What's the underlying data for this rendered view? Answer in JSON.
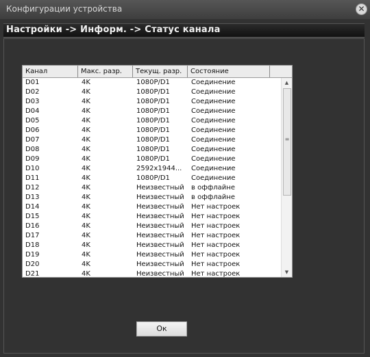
{
  "window": {
    "title": "Конфигурации устройства"
  },
  "breadcrumb": "Настройки -> Информ. -> Статус канала",
  "table": {
    "columns": [
      "Канал",
      "Макс. разр.",
      "Текущ. разр.",
      "Состояние"
    ],
    "rows": [
      [
        "D01",
        "4K",
        "1080P/D1",
        "Соединение"
      ],
      [
        "D02",
        "4K",
        "1080P/D1",
        "Соединение"
      ],
      [
        "D03",
        "4K",
        "1080P/D1",
        "Соединение"
      ],
      [
        "D04",
        "4K",
        "1080P/D1",
        "Соединение"
      ],
      [
        "D05",
        "4K",
        "1080P/D1",
        "Соединение"
      ],
      [
        "D06",
        "4K",
        "1080P/D1",
        "Соединение"
      ],
      [
        "D07",
        "4K",
        "1080P/D1",
        "Соединение"
      ],
      [
        "D08",
        "4K",
        "1080P/D1",
        "Соединение"
      ],
      [
        "D09",
        "4K",
        "1080P/D1",
        "Соединение"
      ],
      [
        "D10",
        "4K",
        "2592x1944...",
        "Соединение"
      ],
      [
        "D11",
        "4K",
        "1080P/D1",
        "Соединение"
      ],
      [
        "D12",
        "4K",
        "Неизвестный",
        "в оффлайне"
      ],
      [
        "D13",
        "4K",
        "Неизвестный",
        "в оффлайне"
      ],
      [
        "D14",
        "4K",
        "Неизвестный",
        "Нет настроек"
      ],
      [
        "D15",
        "4K",
        "Неизвестный",
        "Нет настроек"
      ],
      [
        "D16",
        "4K",
        "Неизвестный",
        "Нет настроек"
      ],
      [
        "D17",
        "4K",
        "Неизвестный",
        "Нет настроек"
      ],
      [
        "D18",
        "4K",
        "Неизвестный",
        "Нет настроек"
      ],
      [
        "D19",
        "4K",
        "Неизвестный",
        "Нет настроек"
      ],
      [
        "D20",
        "4K",
        "Неизвестный",
        "Нет настроек"
      ],
      [
        "D21",
        "4K",
        "Неизвестный",
        "Нет настроек"
      ]
    ]
  },
  "buttons": {
    "ok": "Ок",
    "close_icon": "close-icon"
  }
}
